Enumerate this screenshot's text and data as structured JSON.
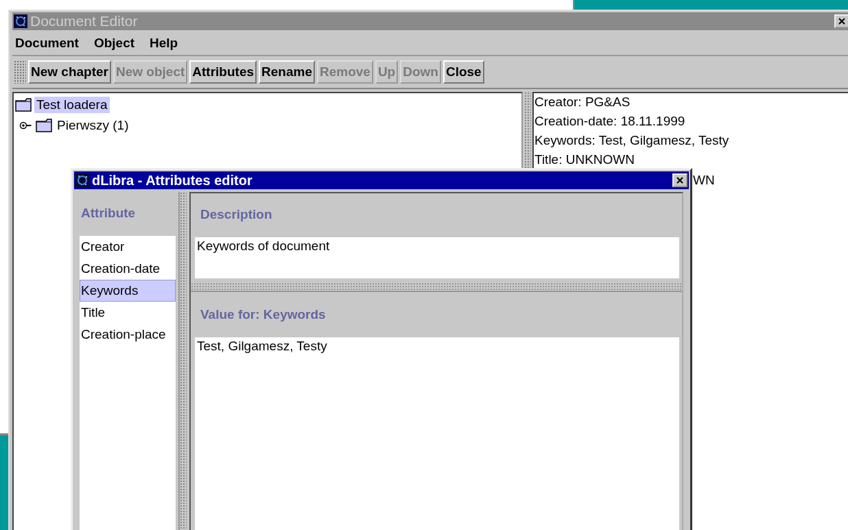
{
  "editor": {
    "title": "Document Editor",
    "active": false,
    "menu": [
      "Document",
      "Object",
      "Help"
    ],
    "toolbar": [
      {
        "label": "New chapter",
        "disabled": false
      },
      {
        "label": "New object",
        "disabled": true
      },
      {
        "label": "Attributes",
        "disabled": false
      },
      {
        "label": "Rename",
        "disabled": false
      },
      {
        "label": "Remove",
        "disabled": true
      },
      {
        "label": "Up",
        "disabled": true
      },
      {
        "label": "Down",
        "disabled": true
      },
      {
        "label": "Close",
        "disabled": false
      }
    ],
    "tree": [
      {
        "label": "Test loadera",
        "selected": true,
        "children": [
          {
            "label": "Pierwszy (1)",
            "selected": false,
            "expanded": false
          }
        ]
      }
    ],
    "details": [
      "Creator: PG&AS",
      "Creation-date: 18.11.1999",
      "Keywords: Test, Gilgamesz, Testy",
      "Title: UNKNOWN",
      "WN"
    ]
  },
  "dialog": {
    "title": "dLibra - Attributes editor",
    "active": true,
    "attribute_header": "Attribute",
    "attributes": [
      {
        "label": "Creator",
        "selected": false
      },
      {
        "label": "Creation-date",
        "selected": false
      },
      {
        "label": "Keywords",
        "selected": true
      },
      {
        "label": "Title",
        "selected": false
      },
      {
        "label": "Creation-place",
        "selected": false
      }
    ],
    "description_header": "Description",
    "description": "Keywords of document",
    "value_header": "Value for: Keywords",
    "value": "Test, Gilgamesz, Testy"
  }
}
